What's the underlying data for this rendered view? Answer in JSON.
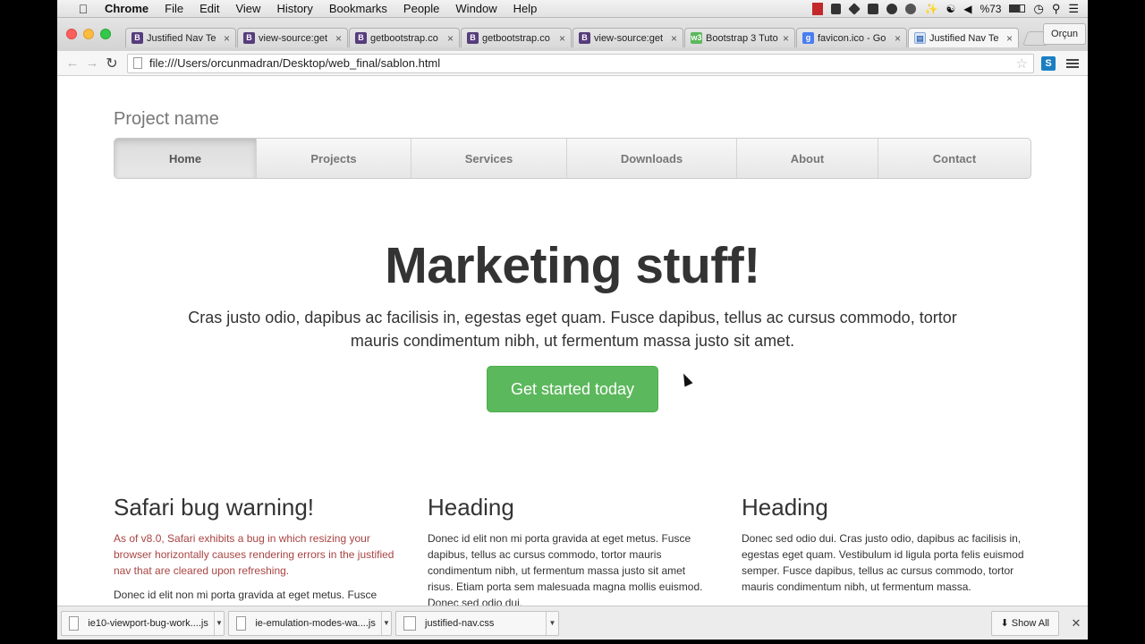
{
  "menubar": {
    "app": "Chrome",
    "items": [
      "File",
      "Edit",
      "View",
      "History",
      "Bookmarks",
      "People",
      "Window",
      "Help"
    ],
    "battery": "%73"
  },
  "browser": {
    "tabs": [
      {
        "title": "Justified Nav Te",
        "favicon": "B",
        "favclass": ""
      },
      {
        "title": "view-source:get",
        "favicon": "B",
        "favclass": ""
      },
      {
        "title": "getbootstrap.co",
        "favicon": "B",
        "favclass": ""
      },
      {
        "title": "getbootstrap.co",
        "favicon": "B",
        "favclass": ""
      },
      {
        "title": "view-source:get",
        "favicon": "B",
        "favclass": ""
      },
      {
        "title": "Bootstrap 3 Tuto",
        "favicon": "w3",
        "favclass": "green"
      },
      {
        "title": "favicon.ico - Go",
        "favicon": "g",
        "favclass": "goog"
      },
      {
        "title": "Justified Nav Te",
        "favicon": "▤",
        "favclass": "light"
      }
    ],
    "active_tab": 7,
    "profile": "Orçun",
    "url": "file:///Users/orcunmadran/Desktop/web_final/sablon.html"
  },
  "page": {
    "brand": "Project name",
    "nav": [
      "Home",
      "Projects",
      "Services",
      "Downloads",
      "About",
      "Contact"
    ],
    "jumbotron": {
      "heading": "Marketing stuff!",
      "lead": "Cras justo odio, dapibus ac facilisis in, egestas eget quam. Fusce dapibus, tellus ac cursus commodo, tortor mauris condimentum nibh, ut fermentum massa justo sit amet.",
      "cta": "Get started today"
    },
    "columns": [
      {
        "heading": "Safari bug warning!",
        "warning": "As of v8.0, Safari exhibits a bug in which resizing your browser horizontally causes rendering errors in the justified nav that are cleared upon refreshing.",
        "text": "Donec id elit non mi porta gravida at eget metus. Fusce"
      },
      {
        "heading": "Heading",
        "text": "Donec id elit non mi porta gravida at eget metus. Fusce dapibus, tellus ac cursus commodo, tortor mauris condimentum nibh, ut fermentum massa justo sit amet risus. Etiam porta sem malesuada magna mollis euismod. Donec sed odio dui."
      },
      {
        "heading": "Heading",
        "text": "Donec sed odio dui. Cras justo odio, dapibus ac facilisis in, egestas eget quam. Vestibulum id ligula porta felis euismod semper. Fusce dapibus, tellus ac cursus commodo, tortor mauris condimentum nibh, ut fermentum massa."
      }
    ]
  },
  "downloads": {
    "items": [
      "ie10-viewport-bug-work....js",
      "ie-emulation-modes-wa....js",
      "justified-nav.css"
    ],
    "show_all": "Show All"
  },
  "colors": {
    "success": "#5cb85c",
    "warning_text": "#a94442"
  }
}
